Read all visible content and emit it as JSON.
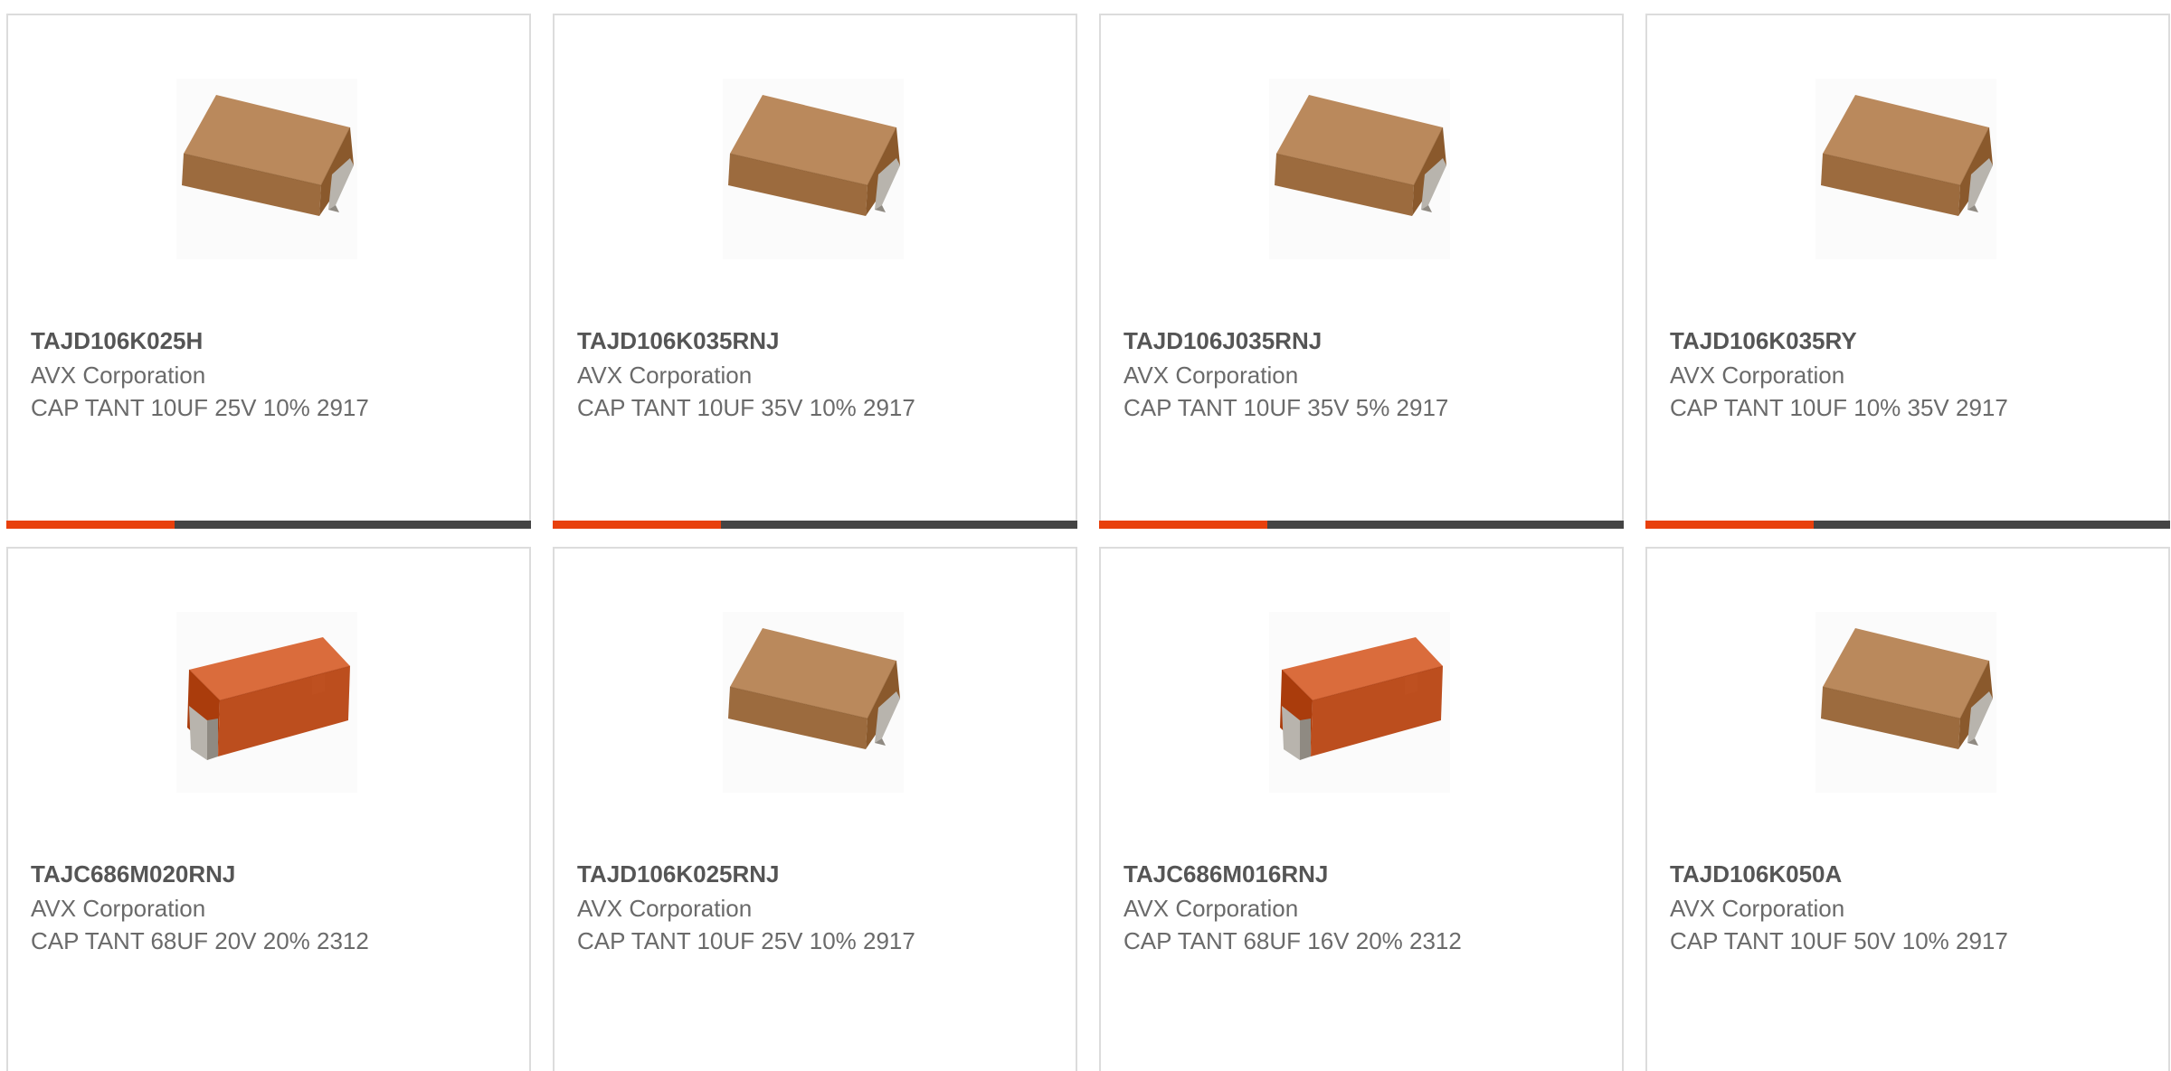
{
  "accent_color": "#e8400c",
  "track_color": "#444444",
  "products": [
    {
      "part_number": "TAJD106K025H",
      "manufacturer": "AVX Corporation",
      "description": "CAP TANT 10UF 25V 10% 2917",
      "image": "tantalum-capacitor-brown-icon",
      "body_color": "#a8774a",
      "progress": 0.32
    },
    {
      "part_number": "TAJD106K035RNJ",
      "manufacturer": "AVX Corporation",
      "description": "CAP TANT 10UF 35V 10% 2917",
      "image": "tantalum-capacitor-brown-icon",
      "body_color": "#a8774a",
      "progress": 0.32
    },
    {
      "part_number": "TAJD106J035RNJ",
      "manufacturer": "AVX Corporation",
      "description": "CAP TANT 10UF 35V 5% 2917",
      "image": "tantalum-capacitor-brown-icon",
      "body_color": "#a8774a",
      "progress": 0.32
    },
    {
      "part_number": "TAJD106K035RY",
      "manufacturer": "AVX Corporation",
      "description": "CAP TANT 10UF 10% 35V 2917",
      "image": "tantalum-capacitor-brown-icon",
      "body_color": "#a8774a",
      "progress": 0.32
    },
    {
      "part_number": "TAJC686M020RNJ",
      "manufacturer": "AVX Corporation",
      "description": "CAP TANT 68UF 20V 20% 2312",
      "image": "tantalum-capacitor-orange-icon",
      "body_color": "#c85a2a"
    },
    {
      "part_number": "TAJD106K025RNJ",
      "manufacturer": "AVX Corporation",
      "description": "CAP TANT 10UF 25V 10% 2917",
      "image": "tantalum-capacitor-brown-icon",
      "body_color": "#a8774a"
    },
    {
      "part_number": "TAJC686M016RNJ",
      "manufacturer": "AVX Corporation",
      "description": "CAP TANT 68UF 16V 20% 2312",
      "image": "tantalum-capacitor-orange-icon",
      "body_color": "#c85a2a"
    },
    {
      "part_number": "TAJD106K050A",
      "manufacturer": "AVX Corporation",
      "description": "CAP TANT 10UF 50V 10% 2917",
      "image": "tantalum-capacitor-brown-icon",
      "body_color": "#a8774a"
    }
  ]
}
